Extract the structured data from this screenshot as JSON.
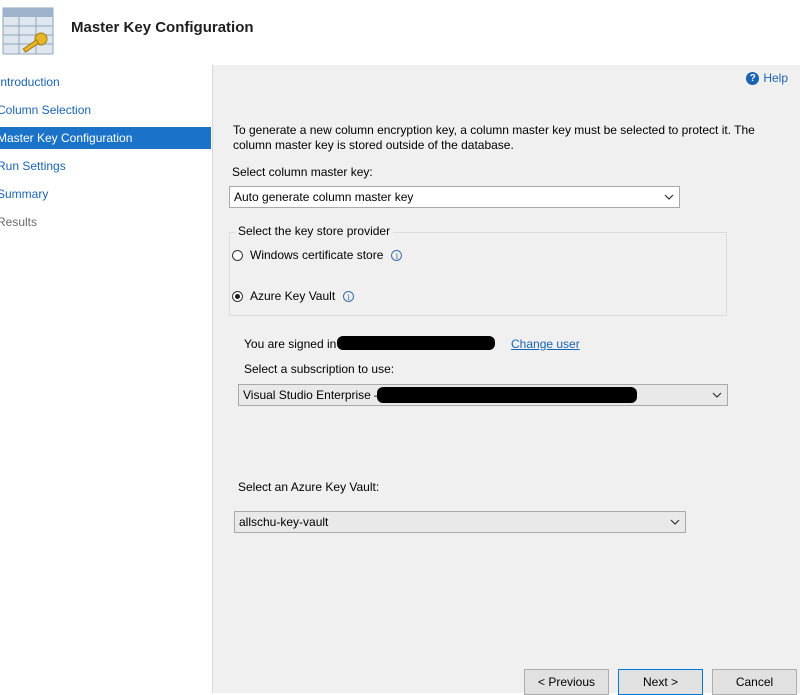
{
  "header": {
    "title": "Master Key Configuration",
    "icon": "key-table-icon"
  },
  "sidebar": {
    "items": [
      {
        "label": "Introduction",
        "state": "link"
      },
      {
        "label": "Column Selection",
        "state": "link"
      },
      {
        "label": "Master Key Configuration",
        "state": "selected"
      },
      {
        "label": "Run Settings",
        "state": "link"
      },
      {
        "label": "Summary",
        "state": "link"
      },
      {
        "label": "Results",
        "state": "disabled"
      }
    ]
  },
  "main": {
    "help_label": "Help",
    "description": "To generate a new column encryption key, a column master key must be selected to protect it.  The column master key is stored outside of the database.",
    "select_cmk_label": "Select column master key:",
    "select_cmk_value": "Auto generate column master key",
    "key_store_group_title": "Select the key store provider",
    "radio_windows_label": "Windows certificate store",
    "radio_azure_label": "Azure Key Vault",
    "radio_selected": "Azure Key Vault",
    "signed_in_label": "You are signed in",
    "change_user_label": "Change user",
    "subscription_label": "Select a subscription to use:",
    "subscription_value": "Visual Studio Enterprise –",
    "key_vault_label": "Select an Azure Key Vault:",
    "key_vault_value": "allschu-key-vault"
  },
  "footer": {
    "previous_label": "< Previous",
    "next_label": "Next >",
    "cancel_label": "Cancel"
  },
  "colors": {
    "accent": "#1a73c8",
    "link": "#1b63b3",
    "panel_bg": "#f0f0f0"
  }
}
